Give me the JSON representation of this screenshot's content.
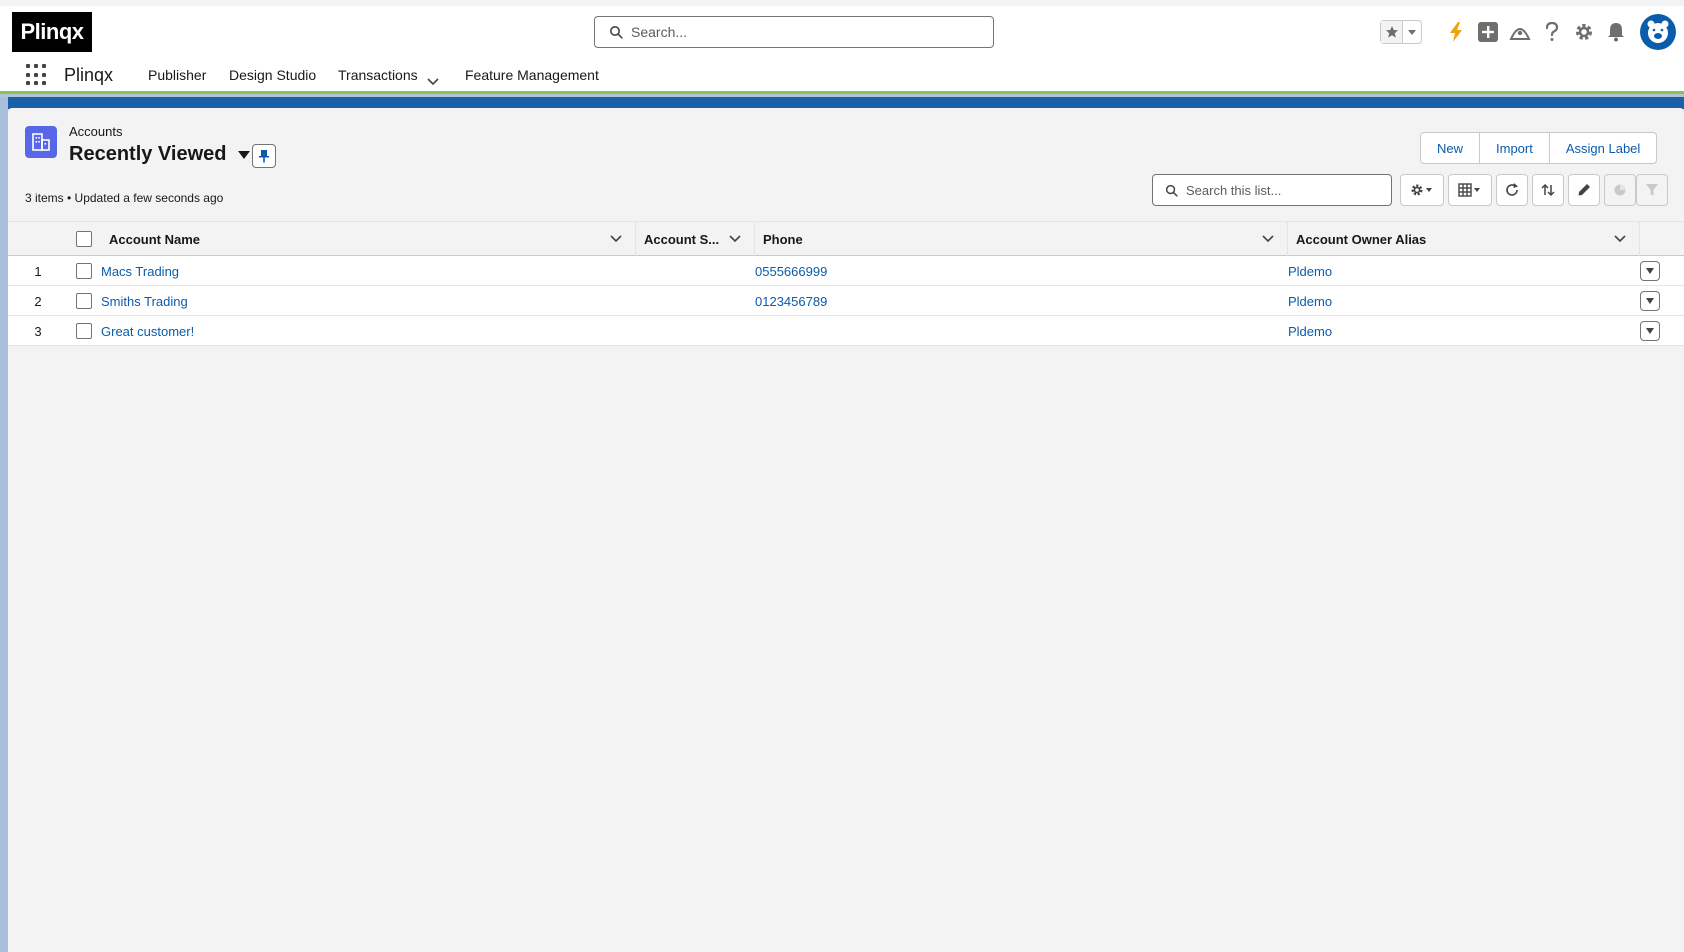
{
  "header": {
    "logo_text": "Plinqx",
    "search_placeholder": "Search..."
  },
  "nav": {
    "app_name": "Plinqx",
    "items": [
      "Publisher",
      "Design Studio",
      "Transactions",
      "Feature Management"
    ]
  },
  "list": {
    "object_label": "Accounts",
    "view_name": "Recently Viewed",
    "meta": "3 items • Updated a few seconds ago",
    "search_placeholder": "Search this list...",
    "buttons": {
      "new": "New",
      "import": "Import",
      "assign_label": "Assign Label"
    }
  },
  "table": {
    "columns": [
      "Account Name",
      "Account S...",
      "Phone",
      "Account Owner Alias"
    ],
    "rows": [
      {
        "num": "1",
        "name": "Macs Trading",
        "site": "",
        "phone": "0555666999",
        "owner": "Pldemo"
      },
      {
        "num": "2",
        "name": "Smiths Trading",
        "site": "",
        "phone": "0123456789",
        "owner": "Pldemo"
      },
      {
        "num": "3",
        "name": "Great customer!",
        "site": "",
        "phone": "",
        "owner": "Pldemo"
      }
    ]
  },
  "colors": {
    "accent": "#0b5cab",
    "object_icon": "#5867e8",
    "nav_underline": "#8cc63f",
    "banner": "#1b5fa8"
  }
}
